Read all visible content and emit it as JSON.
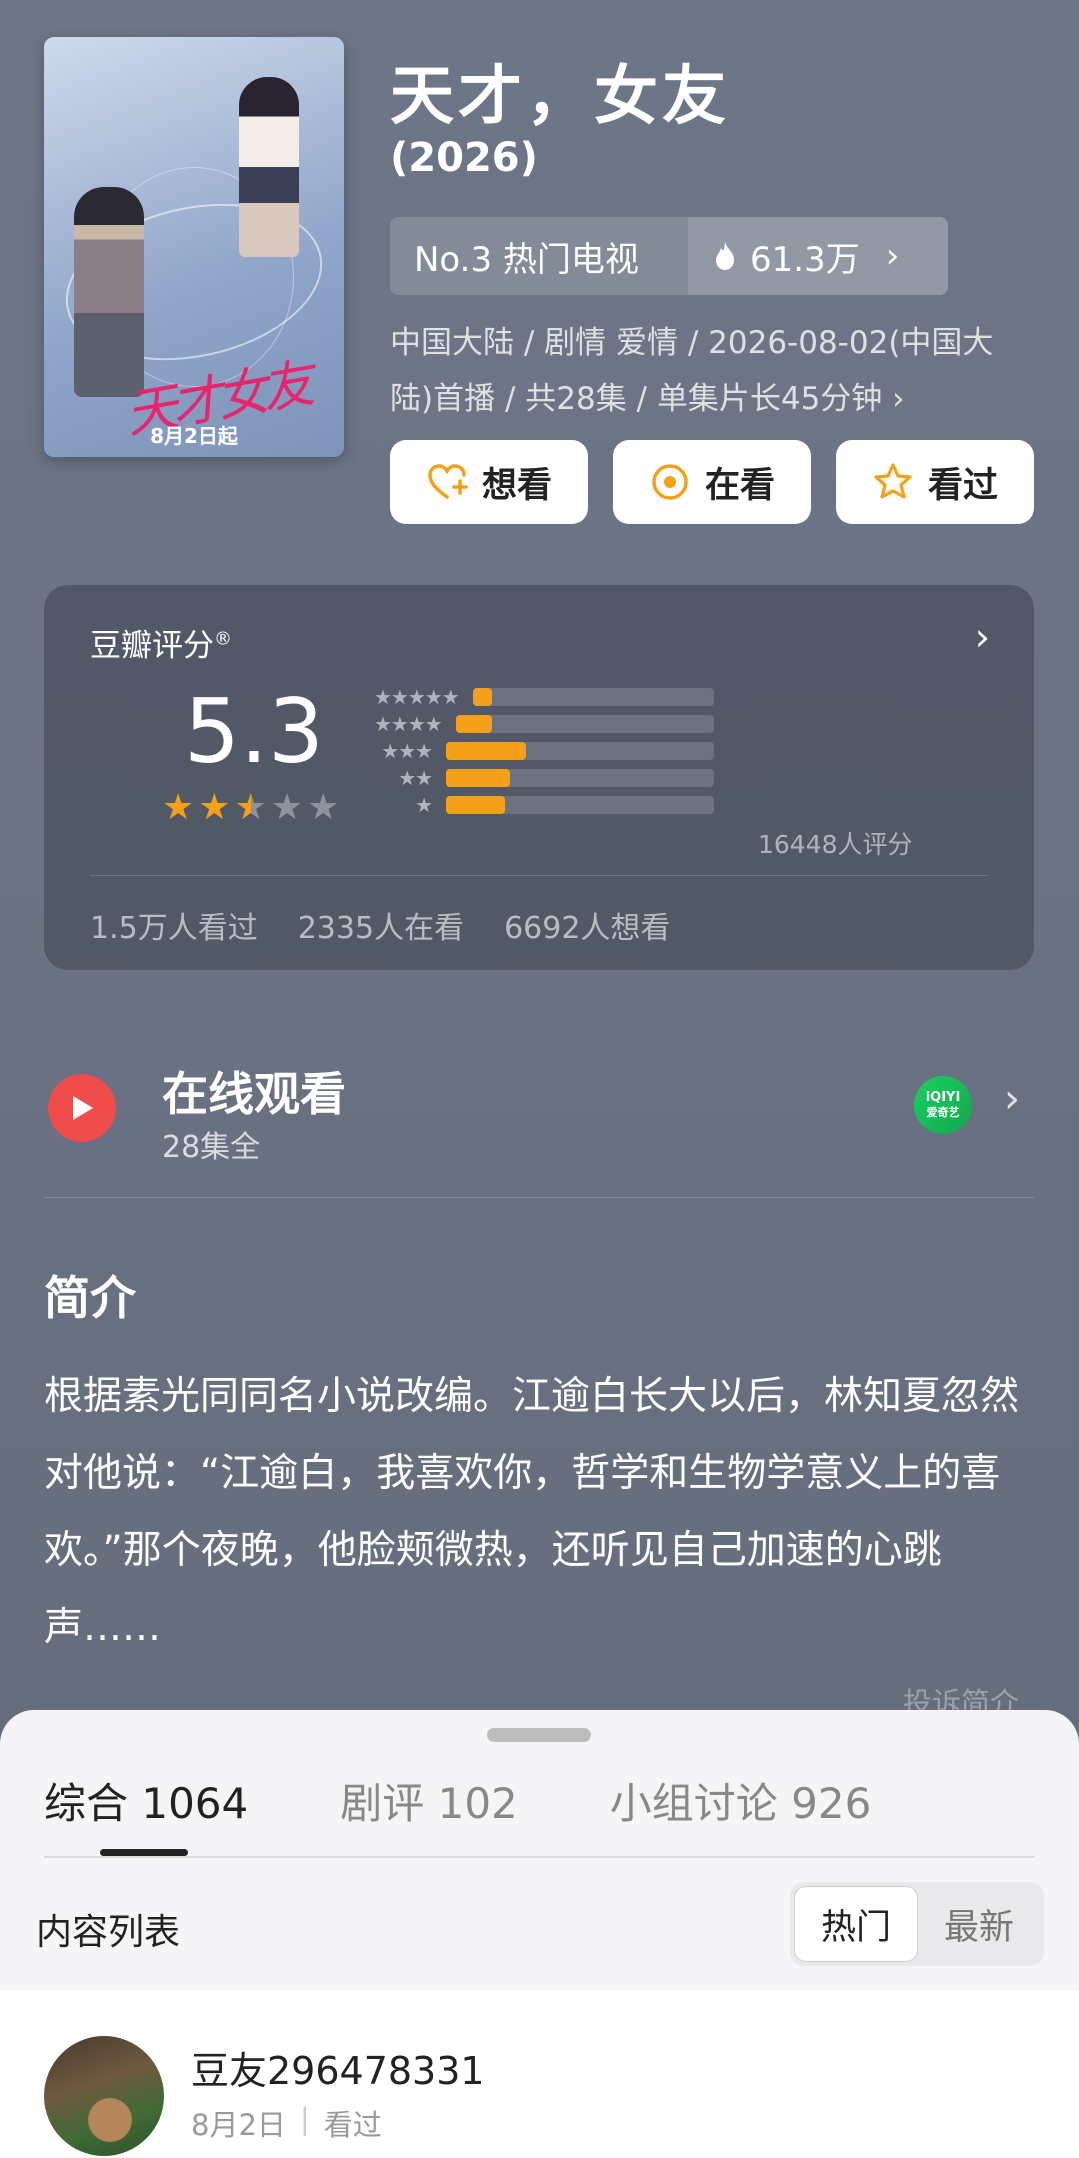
{
  "poster": {
    "title_art": "天才女友",
    "date_text": "8月2日起"
  },
  "header": {
    "title": "天才，女友",
    "year": "(2026)",
    "rank_text": "No.3 热门电视",
    "heat_text": "61.3万",
    "meta_line1": "中国大陆 / 剧情 爱情 / 2026-08-02(中国大",
    "meta_line2": "陆)首播 / 共28集 / 单集片长45分钟 ›"
  },
  "actions": [
    {
      "label": "想看",
      "icon": "heart-plus-icon"
    },
    {
      "label": "在看",
      "icon": "target-icon"
    },
    {
      "label": "看过",
      "icon": "star-outline-icon"
    }
  ],
  "rating": {
    "label": "豆瓣评分",
    "mark": "®",
    "score": "5.3",
    "stars_value": 2.5,
    "distribution": [
      {
        "stars": "★★★★★",
        "fraction": 0.08
      },
      {
        "stars": "★★★★",
        "fraction": 0.14
      },
      {
        "stars": "★★★",
        "fraction": 0.3
      },
      {
        "stars": "★★",
        "fraction": 0.24
      },
      {
        "stars": "★",
        "fraction": 0.22
      }
    ],
    "count_text": "16448人评分",
    "watched": "1.5万人看过",
    "watching": "2335人在看",
    "want": "6692人想看",
    "accent": "#f5a019"
  },
  "watch": {
    "title": "在线观看",
    "subtitle": "28集全",
    "provider_top": "iQIYI",
    "provider_bottom": "爱奇艺"
  },
  "intro": {
    "heading": "简介",
    "text": "根据素光同同名小说改编。江逾白长大以后，林知夏忽然对他说：“江逾白，我喜欢你，哲学和生物学意义上的喜欢。”那个夜晚，他脸颊微热，还听见自己加速的心跳声……",
    "complaint": "投诉简介"
  },
  "sheet": {
    "tabs": [
      {
        "label": "综合 1064",
        "active": true
      },
      {
        "label": "剧评 102",
        "active": false
      },
      {
        "label": "小组讨论 926",
        "active": false
      }
    ],
    "list_label": "内容列表",
    "sort_hot": "热门",
    "sort_new": "最新"
  },
  "post": {
    "username": "豆友296478331",
    "date": "8月2日",
    "status": "看过"
  }
}
